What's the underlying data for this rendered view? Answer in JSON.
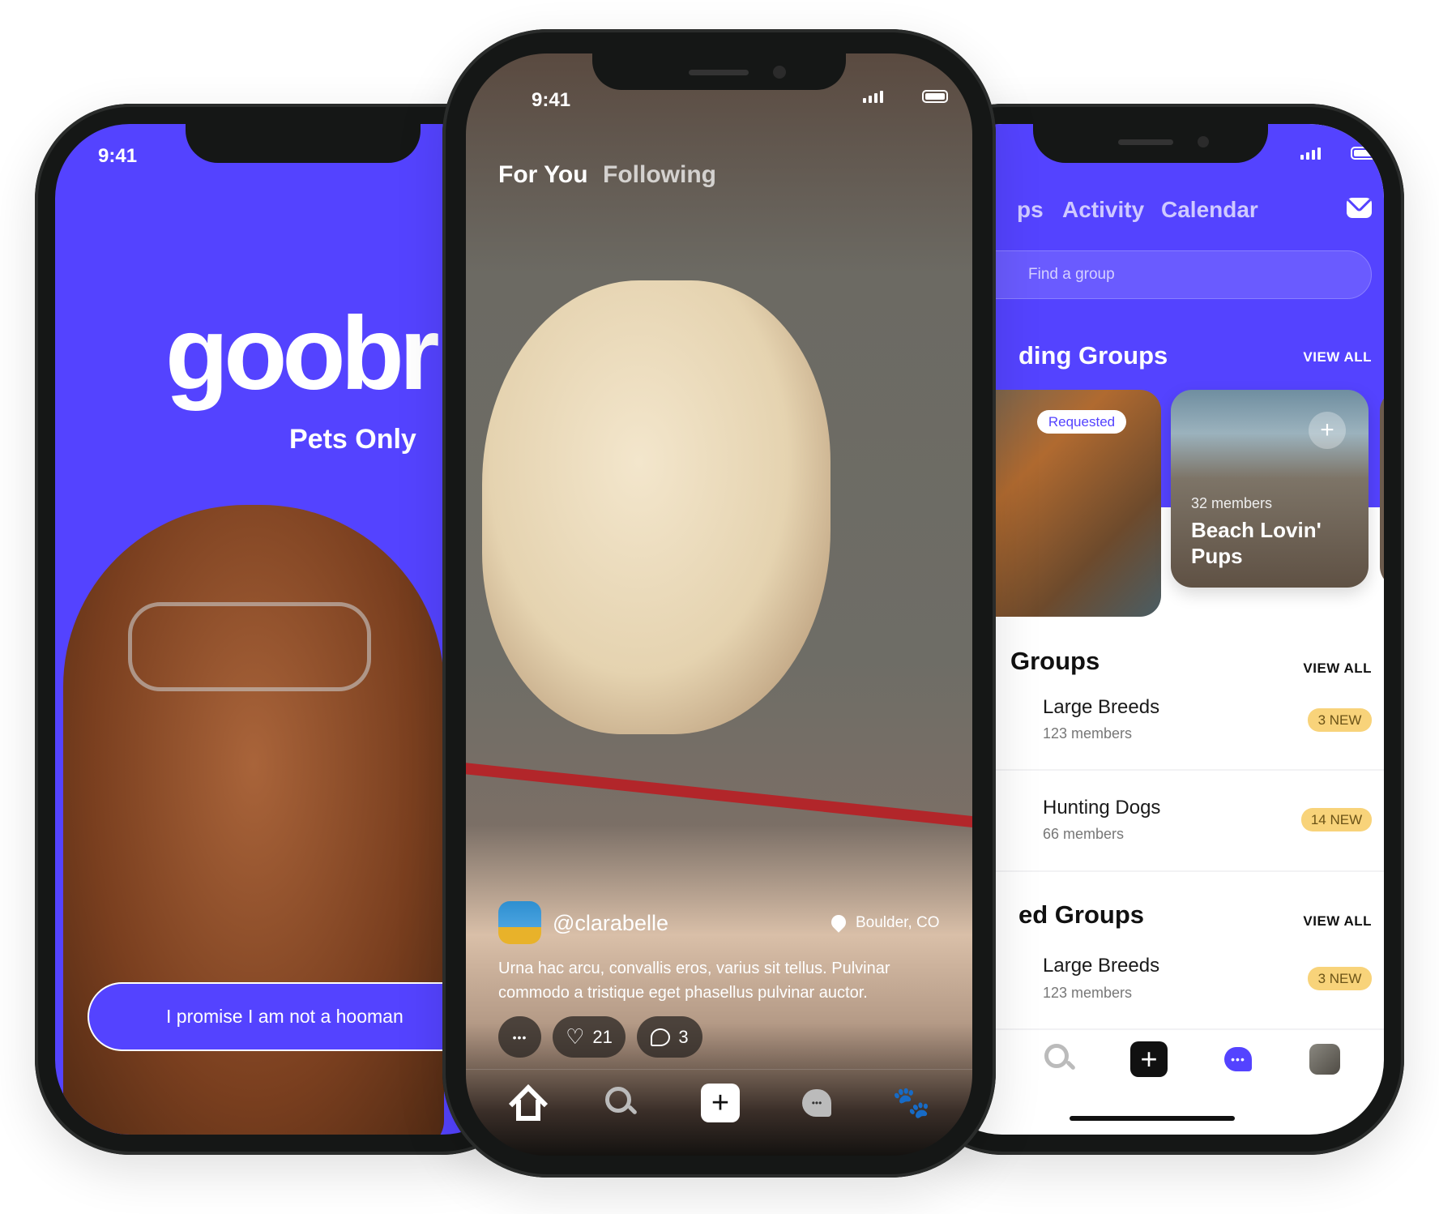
{
  "colors": {
    "brand": "#5443FF",
    "badge": "#F8D37A",
    "dark": "#151716"
  },
  "left_screen": {
    "status_time": "9:41",
    "logo": "goobr",
    "tagline": "Pets Only",
    "cta_button": "I promise I am not a hooman"
  },
  "center_screen": {
    "status_time": "9:41",
    "tabs": [
      {
        "label": "For You",
        "active": true
      },
      {
        "label": "Following",
        "active": false
      }
    ],
    "post": {
      "username": "@clarabelle",
      "location": "Boulder, CO",
      "caption": "Urna hac arcu, convallis eros, varius sit tellus. Pulvinar commodo a tristique eget phasellus pulvinar auctor.",
      "likes": "21",
      "comments": "3",
      "more_icon": "ellipsis-icon"
    },
    "nav": [
      "home-icon",
      "search-icon",
      "plus-icon",
      "chat-icon",
      "paw-icon"
    ]
  },
  "right_screen": {
    "tabs": [
      "ps",
      "Activity",
      "Calendar"
    ],
    "search_placeholder": "Find a group",
    "trending": {
      "title": "ding Groups",
      "view_all": "VIEW ALL",
      "cards": [
        {
          "badge": "Requested"
        },
        {
          "members": "32 members",
          "name": "Beach Lovin' Pups"
        }
      ]
    },
    "my_groups": {
      "title": "Groups",
      "view_all": "VIEW ALL",
      "rows": [
        {
          "name": "Large Breeds",
          "members": "123 members",
          "badge": "3 NEW"
        },
        {
          "name": "Hunting Dogs",
          "members": "66 members",
          "badge": "14 NEW"
        }
      ]
    },
    "other_groups": {
      "title": "ed Groups",
      "view_all": "VIEW ALL",
      "rows": [
        {
          "name": "Large Breeds",
          "members": "123 members",
          "badge": "3 NEW"
        }
      ]
    },
    "nav": [
      "search-icon",
      "plus-icon",
      "chat-icon",
      "profile-avatar"
    ]
  }
}
